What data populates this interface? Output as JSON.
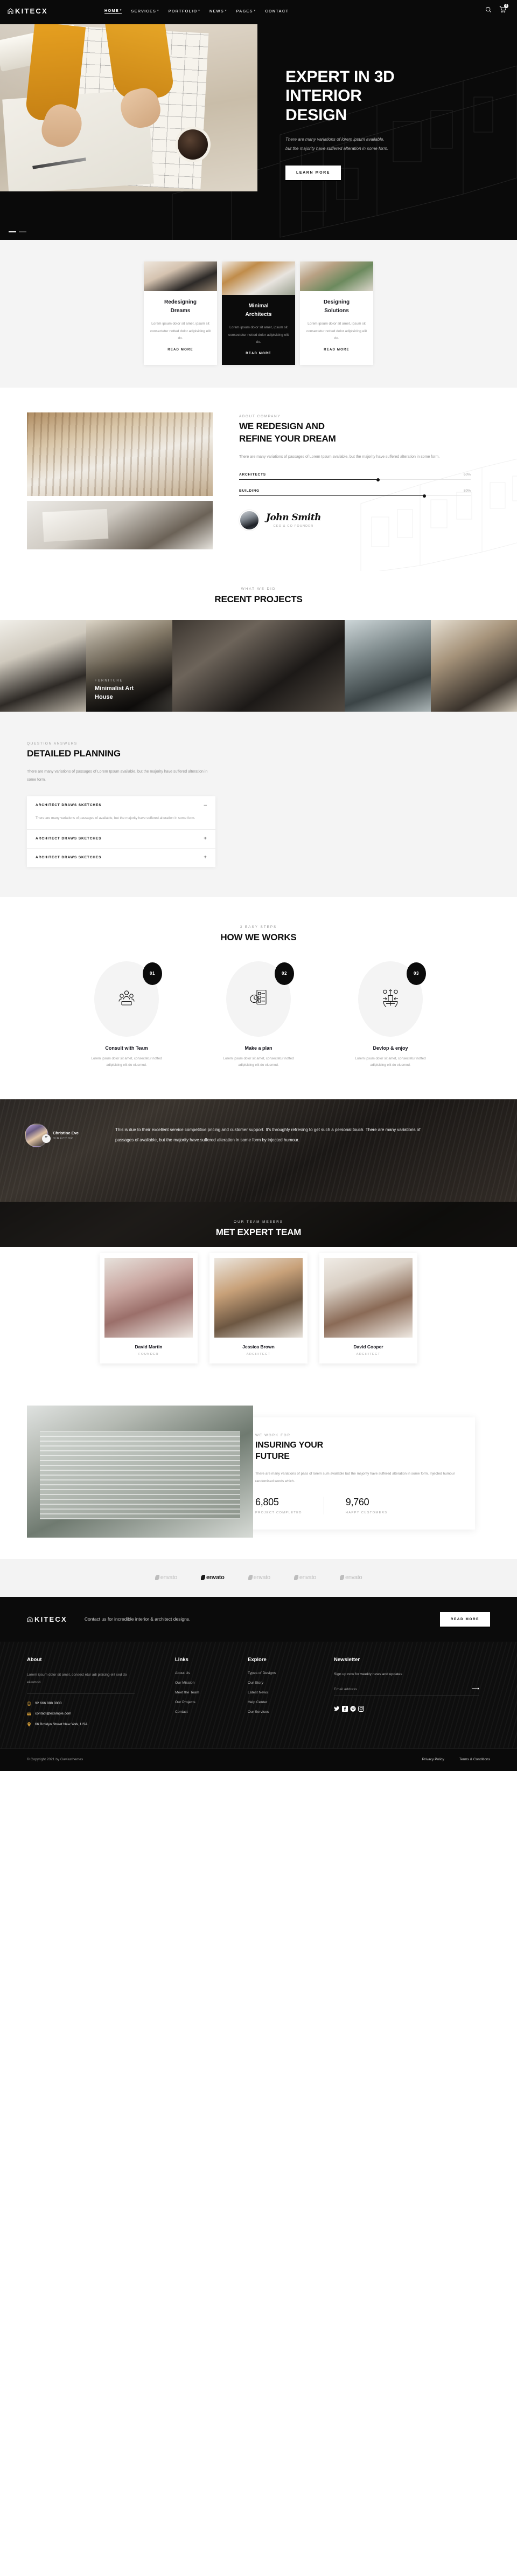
{
  "header": {
    "brand": "KITECX",
    "nav": [
      {
        "label": "HOME",
        "caret": true,
        "active": true
      },
      {
        "label": "SERVICES",
        "caret": true,
        "active": false
      },
      {
        "label": "PORTFOLIO",
        "caret": true,
        "active": false
      },
      {
        "label": "NEWS",
        "caret": true,
        "active": false
      },
      {
        "label": "PAGES",
        "caret": true,
        "active": false
      },
      {
        "label": "CONTACT",
        "caret": false,
        "active": false
      }
    ],
    "cart_count": "0"
  },
  "hero": {
    "title_line1": "EXPERT IN 3D",
    "title_line2": "INTERIOR",
    "title_line3": "DESIGN",
    "sub_line1": "There are many variations of lorem ipsum available,",
    "sub_line2": "but the majority have suffered alteration in some form.",
    "button": "LEARN MORE"
  },
  "services": [
    {
      "title_line1": "Redesigning",
      "title_line2": "Dreams",
      "text": "Lorem ipsum dolor sit amet, ipsum sit consectetur notted dolor adipisicing elit do.",
      "more": "READ MORE",
      "dark": false
    },
    {
      "title_line1": "Minimal",
      "title_line2": "Architects",
      "text": "Lorem ipsum dolor sit amet, ipsum sit consectetur notted dolor adipisicing elit do.",
      "more": "READ MORE",
      "dark": true
    },
    {
      "title_line1": "Designing",
      "title_line2": "Solutions",
      "text": "Lorem ipsum dolor sit amet, ipsum sit consectetur notted dolor adipisicing elit do.",
      "more": "READ MORE",
      "dark": false
    }
  ],
  "about": {
    "eyebrow": "ABOUT COMPANY",
    "title_line1": "WE REDESIGN AND",
    "title_line2": "REFINE YOUR DREAM",
    "paragraph": "There are many variations of passages of Lorem Ipsum available, but the majority have suffered alteration in some form.",
    "skills": [
      {
        "name": "ARCHITECTS",
        "pct": "60%",
        "value": 60
      },
      {
        "name": "BUILDING",
        "pct": "80%",
        "value": 80
      }
    ],
    "signature_name": "John Smith",
    "signature_role": "CEO & CO FOUNDER"
  },
  "projects": {
    "eyebrow": "WHAT WE DID",
    "title": "RECENT PROJECTS",
    "featured": {
      "category": "FURNITURE",
      "name_line1": "Minimalist Art",
      "name_line2": "House"
    }
  },
  "planning": {
    "eyebrow": "QUESTION ANSWERS",
    "title": "DETAILED PLANNING",
    "paragraph": "There are many variations of passages of Lorem Ipsum available, but the majority have suffered alteration in some form.",
    "accordion": [
      {
        "title": "ARCHITECT DRAWS SKETCHES",
        "sign": "–",
        "open": true,
        "body": "There are many variations of passages of available, but the majority have suffered alteration in some form."
      },
      {
        "title": "ARCHITECT DRAWS SKETCHES",
        "sign": "+",
        "open": false,
        "body": ""
      },
      {
        "title": "ARCHITECT DRAWS SKETCHES",
        "sign": "+",
        "open": false,
        "body": ""
      }
    ]
  },
  "how_we_works": {
    "eyebrow": "3 EASY STEPS",
    "title": "HOW WE WORKS",
    "steps": [
      {
        "num": "01",
        "icon": "team-group-icon",
        "label": "Consult with Team",
        "text": "Lorem ipsum dolor sit amet, consectetur notted adipisicing elit do eiusmod."
      },
      {
        "num": "02",
        "icon": "checklist-clock-icon",
        "label": "Make a plan",
        "text": "Lorem ipsum dolor sit amet, consectetur notted adipisicing elit do eiusmod."
      },
      {
        "num": "03",
        "icon": "global-growth-icon",
        "label": "Devlop & enjoy",
        "text": "Lorem ipsum dolor sit amet, consectetur notted adipisicing elit do eiusmod."
      }
    ]
  },
  "testimonial": {
    "name": "Christine Eve",
    "role": "DIRECTOR",
    "quote_mark": "”",
    "quote": "This is due to their excellent service competitive pricing and customer support. It's throughly refresing to get such a personal touch. There are many variations of passages of available, but the majority have suffered alteration in some form by injected humour."
  },
  "team": {
    "eyebrow": "OUR TEAM MEBERS",
    "title": "MET EXPERT TEAM",
    "members": [
      {
        "name": "David Martin",
        "role": "FOUNDER"
      },
      {
        "name": "Jessica Brown",
        "role": "ARCHITECT"
      },
      {
        "name": "David Cooper",
        "role": "ARCHITECT"
      }
    ]
  },
  "insuring": {
    "eyebrow": "WE WORK FOR",
    "title_line1": "INSURING YOUR",
    "title_line2": "FUTURE",
    "paragraph": "There are many variations of pass of lorem sum available but the majority have suffered alteration in some form. Injected humour randomised words which.",
    "stats": [
      {
        "num": "6,805",
        "label": "PROJECT COMPLETED"
      },
      {
        "num": "9,760",
        "label": "HAPPY CUSTOMERS"
      }
    ]
  },
  "brands": [
    {
      "label": "envato",
      "active": false
    },
    {
      "label": "envato",
      "active": true
    },
    {
      "label": "envato",
      "active": false
    },
    {
      "label": "envato",
      "active": false
    },
    {
      "label": "envato",
      "active": false
    }
  ],
  "cta": {
    "brand": "KITECX",
    "text": "Contact us for incredible interior & architect designs.",
    "button": "READ MORE"
  },
  "footer": {
    "about": {
      "heading": "About",
      "text": "Lorem ipsum dolor sit amet, consect etur adi pisicing elit sed do eiusmod.",
      "contacts": [
        {
          "icon": "phone-icon",
          "value": "92 666 888 0000"
        },
        {
          "icon": "mail-icon",
          "value": "contact@example.com"
        },
        {
          "icon": "location-pin-icon",
          "value": "66 Broklyn Street New York, USA"
        }
      ]
    },
    "links": {
      "heading": "Links",
      "items": [
        "About Us",
        "Our Mission",
        "Meet the Team",
        "Our Projects",
        "Contact"
      ]
    },
    "explore": {
      "heading": "Explore",
      "items": [
        "Types of Designs",
        "Our Story",
        "Latest News",
        "Help Center",
        "Our Services"
      ]
    },
    "newsletter": {
      "heading": "Newsletter",
      "text": "Sign up now for weekly news and updates",
      "placeholder": "Email address",
      "submit_icon": "arrow-right-icon",
      "socials": [
        "twitter-icon",
        "facebook-icon",
        "pinterest-icon",
        "instagram-icon"
      ]
    },
    "copyright": "© Copyright 2021 by Gaviasthemes",
    "legal": [
      "Privacy Policy",
      "Terms & Conditions"
    ]
  }
}
